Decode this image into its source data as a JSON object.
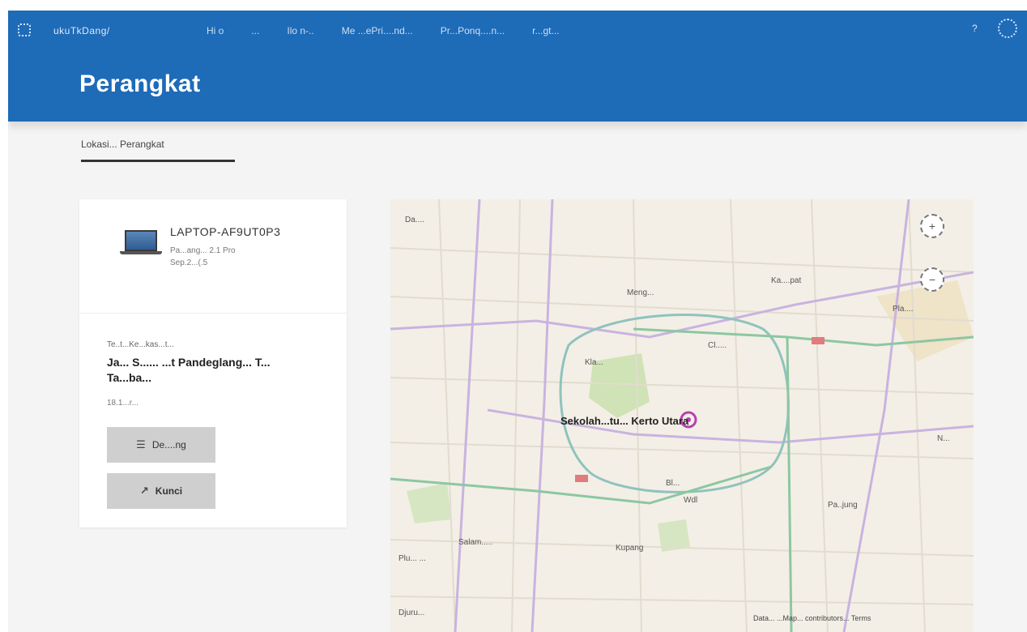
{
  "header": {
    "brand": "ukuTkDang/",
    "nav_links": [
      "Hi o",
      "...",
      "Ilo n-..",
      "Me ...ePri....nd...",
      "Pr...Ponq....n...",
      "r...gt..."
    ],
    "page_title": "Perangkat"
  },
  "tabs": [
    {
      "label": "Lokasi... Perangkat",
      "active": true
    }
  ],
  "device": {
    "name": "LAPTOP-AF9UT0P3",
    "subtitle_1": "Pa...ang... 2.1 Pro",
    "subtitle_2": "Sep.2...(.5",
    "last_seen_label": "Te..t...Ke...kas...t...",
    "location": "Ja... S...... ...t Pandeglang... T... Ta...ba...",
    "time": "18.1...r...",
    "ring_button": "De....ng",
    "lock_button": "Kunci"
  },
  "map": {
    "center_label": "Sekolah...tu... Kerto Utara",
    "place_labels": [
      "Da....",
      "Meng...",
      "Ka....pat",
      "Pla....",
      "Kla...",
      "Cl.....",
      "N...",
      "Salam.....",
      "Wdl",
      "Pa..jung",
      "Plu... ...",
      "Djuru...",
      "Kupang",
      "Bl..."
    ],
    "zoom_in": "+",
    "zoom_out": "−",
    "attribution": "Data... ...Map... contributors... Terms"
  },
  "icons": {
    "menu": "grid-menu-icon",
    "help": "help-icon",
    "account": "account-icon",
    "ring": "ring-icon",
    "lock": "lock-icon",
    "pin": "location-pin-icon"
  },
  "colors": {
    "header": "#1e6bb8",
    "page_bg": "#f4f4f4",
    "button": "#cfcfcf",
    "map_bg": "#f3efe6",
    "pin": "#b93fb2"
  }
}
